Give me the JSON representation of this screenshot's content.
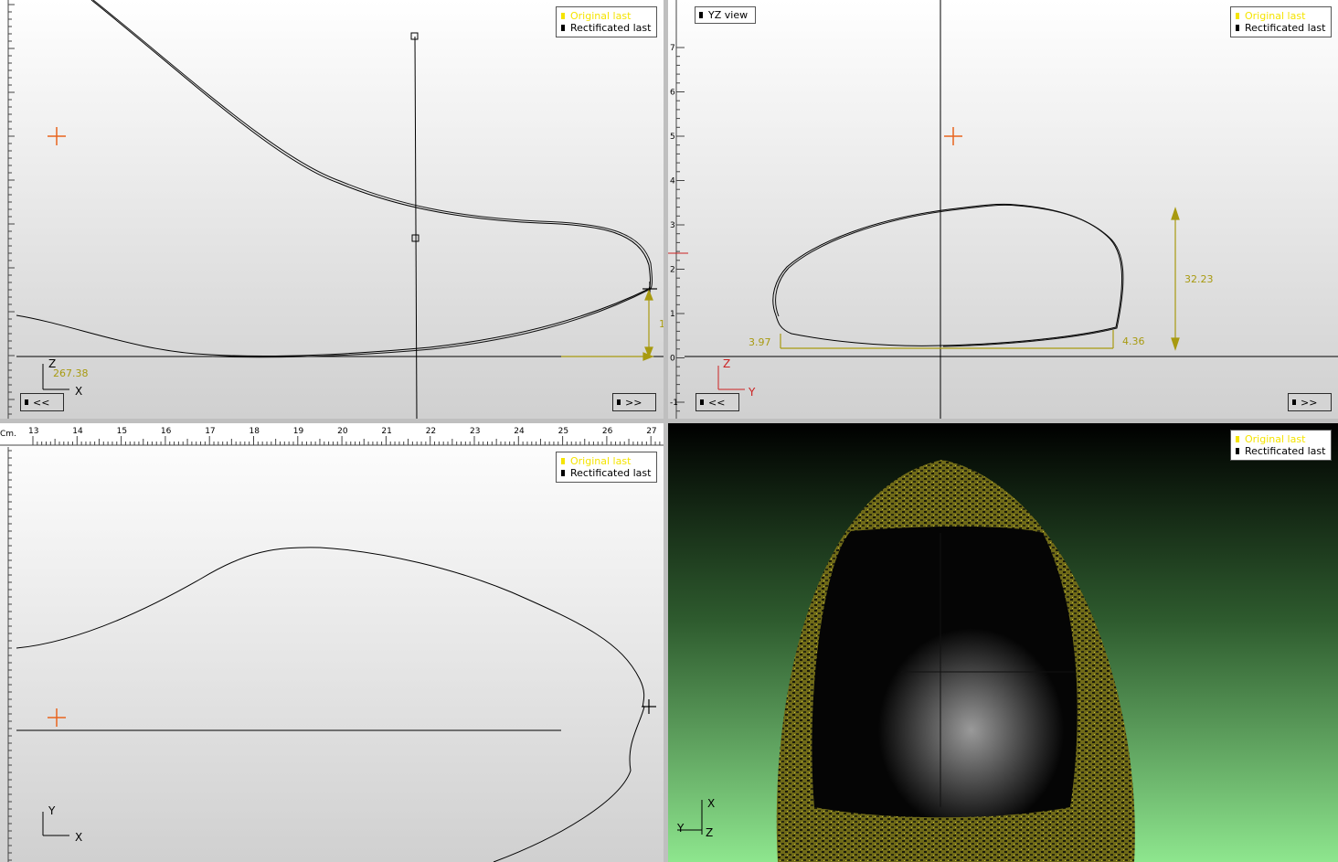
{
  "legend": {
    "original_label": "Original last",
    "rectified_label": "Rectificated last"
  },
  "nav": {
    "prev_label": "<<",
    "next_label": ">>"
  },
  "top_left_view": {
    "dimension_value": "267.38",
    "height_value_partial": "1",
    "axis_up": "Z",
    "axis_right": "X"
  },
  "top_right_view": {
    "title": "YZ view",
    "height_value": "32.23",
    "left_value": "3.97",
    "right_value": "4.36",
    "axis_up": "Z",
    "axis_right": "Y",
    "ruler_ticks": [
      "7",
      "6",
      "5",
      "4",
      "3",
      "2",
      "1",
      "0",
      "-1"
    ]
  },
  "bottom_left_view": {
    "ruler_unit": "Cm.",
    "ruler_ticks": [
      "13",
      "14",
      "15",
      "16",
      "17",
      "18",
      "19",
      "20",
      "21",
      "22",
      "23",
      "24",
      "25",
      "26",
      "27"
    ],
    "axis_up": "Y",
    "axis_right": "X"
  },
  "bottom_right_view": {
    "axis_up": "X",
    "axis_left": "Y",
    "axis_down": "Z"
  },
  "colors": {
    "original": "#f5e400",
    "rectified": "#000000",
    "measure": "#a89a10",
    "marker": "#e8641e",
    "bg3d_top": "#000000",
    "bg3d_bottom": "#8ee68e"
  }
}
